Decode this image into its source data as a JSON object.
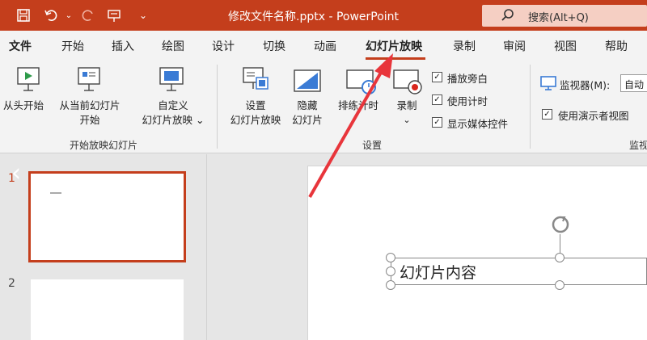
{
  "titlebar": {
    "document_title": "修改文件名称.pptx - PowerPoint",
    "search_label": "搜索(Alt+Q)",
    "accent_color": "#c43e1c",
    "quick_access": [
      "save-icon",
      "undo-icon",
      "redo-icon",
      "present-icon",
      "customize-icon"
    ]
  },
  "tabs": [
    "文件",
    "开始",
    "插入",
    "绘图",
    "设计",
    "切换",
    "动画",
    "幻灯片放映",
    "录制",
    "审阅",
    "视图",
    "帮助"
  ],
  "active_tab": "幻灯片放映",
  "ribbon": {
    "start_group": {
      "from_beginning": "从头开始",
      "from_current_line1": "从当前幻灯片",
      "from_current_line2": "开始",
      "custom_line1": "自定义",
      "custom_line2": "幻灯片放映 ⌄",
      "label": "开始放映幻灯片"
    },
    "setup_group": {
      "setup_line1": "设置",
      "setup_line2": "幻灯片放映",
      "hide_line1": "隐藏",
      "hide_line2": "幻灯片",
      "rehearse_label": "排练计时",
      "record_label": "录制",
      "record_chevron": "⌄",
      "checkboxes": [
        {
          "label": "播放旁白",
          "checked": true
        },
        {
          "label": "使用计时",
          "checked": true
        },
        {
          "label": "显示媒体控件",
          "checked": true
        }
      ],
      "label": "设置"
    },
    "monitor_group": {
      "monitor_label": "监视器(M):",
      "monitor_value": "自动",
      "presenter_view_label": "使用演示者视图",
      "presenter_view_checked": true,
      "label": "监视"
    }
  },
  "slides": {
    "numbers": [
      "1",
      "2"
    ],
    "content_text": "幻灯片内容"
  }
}
